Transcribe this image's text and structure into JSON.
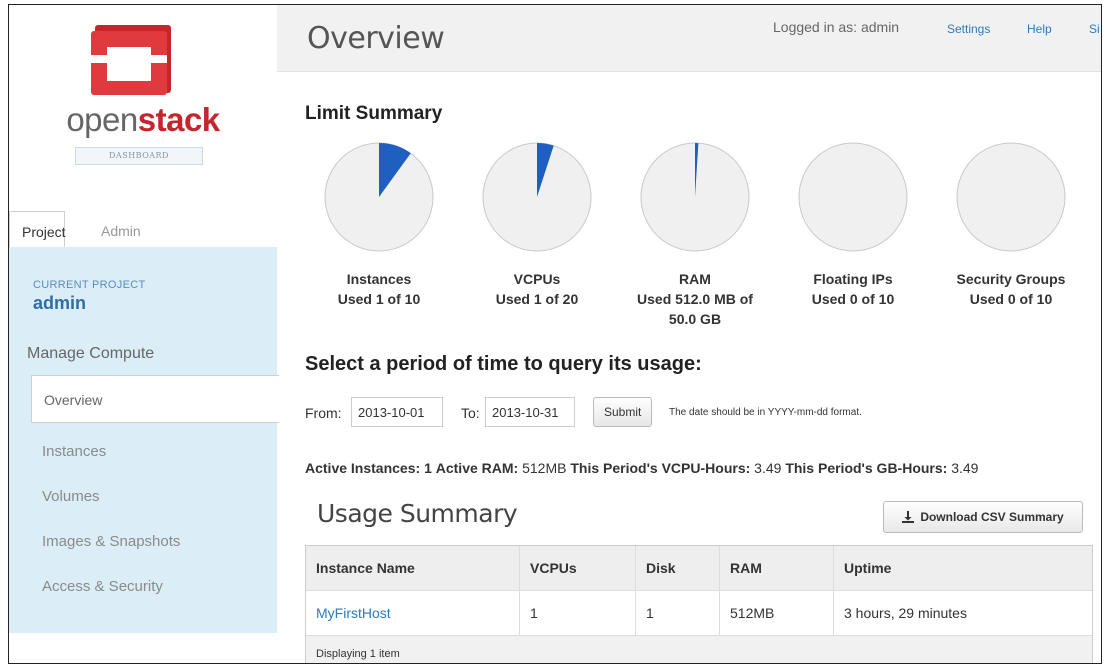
{
  "brand": {
    "name_prefix": "open",
    "name_suffix": "stack",
    "subtitle": "DASHBOARD"
  },
  "sidebar": {
    "tabs": [
      {
        "label": "Project",
        "active": true
      },
      {
        "label": "Admin",
        "active": false
      }
    ],
    "current_project_label": "CURRENT PROJECT",
    "current_project": "admin",
    "section_title": "Manage Compute",
    "items": [
      {
        "label": "Overview",
        "active": true
      },
      {
        "label": "Instances"
      },
      {
        "label": "Volumes"
      },
      {
        "label": "Images & Snapshots"
      },
      {
        "label": "Access & Security"
      }
    ]
  },
  "header": {
    "title": "Overview",
    "logged_in": "Logged in as: admin",
    "links": [
      "Settings",
      "Help",
      "Si"
    ]
  },
  "limit_summary": {
    "title": "Limit Summary",
    "items": [
      {
        "name": "Instances",
        "used_text": "Used 1 of 10",
        "fraction": 0.1
      },
      {
        "name": "VCPUs",
        "used_text": "Used 1 of 20",
        "fraction": 0.05
      },
      {
        "name": "RAM",
        "used_text": "Used 512.0 MB of 50.0 GB",
        "fraction": 0.01
      },
      {
        "name": "Floating IPs",
        "used_text": "Used 0 of 10",
        "fraction": 0
      },
      {
        "name": "Security Groups",
        "used_text": "Used 0 of 10",
        "fraction": 0
      }
    ],
    "pie_fill": "#1f5fbf",
    "pie_bg": "#f0f0f0"
  },
  "period": {
    "title": "Select a period of time to query its usage:",
    "from_label": "From:",
    "from_value": "2013-10-01",
    "to_label": "To:",
    "to_value": "2013-10-31",
    "submit_label": "Submit",
    "hint": "The date should be in YYYY-mm-dd format."
  },
  "active_summary": {
    "instances_label": "Active Instances:",
    "instances_value": "1",
    "ram_label": "Active RAM:",
    "ram_value": "512MB",
    "vcpu_label": "This Period's VCPU-Hours:",
    "vcpu_value": "3.49",
    "gb_label": "This Period's GB-Hours:",
    "gb_value": "3.49"
  },
  "usage": {
    "title": "Usage Summary",
    "csv_button": "Download CSV Summary",
    "columns": [
      "Instance Name",
      "VCPUs",
      "Disk",
      "RAM",
      "Uptime"
    ],
    "rows": [
      {
        "name": "MyFirstHost",
        "vcpus": "1",
        "disk": "1",
        "ram": "512MB",
        "uptime": "3 hours, 29 minutes"
      }
    ],
    "footer": "Displaying 1 item"
  }
}
